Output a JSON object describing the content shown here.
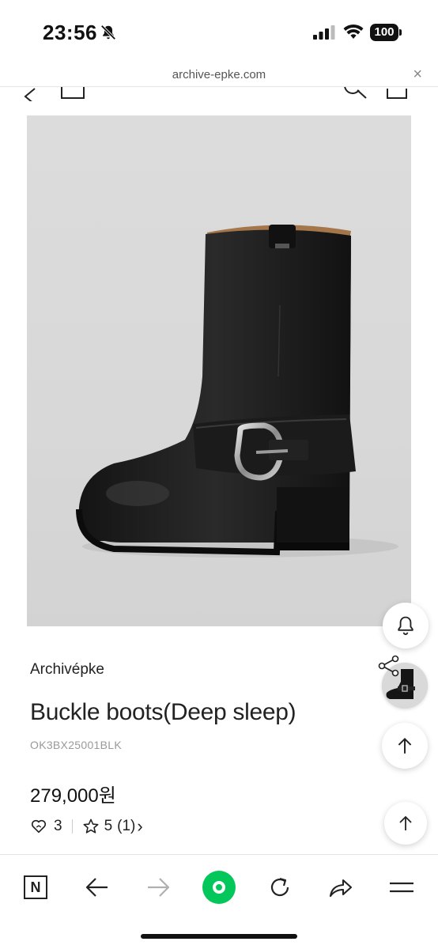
{
  "status_bar": {
    "time": "23:56",
    "battery": "100",
    "icons": [
      "bell-slash-icon",
      "cellular-signal-icon",
      "wifi-icon",
      "battery-icon"
    ]
  },
  "browser": {
    "url": "archive-epke.com",
    "close_icon": "×"
  },
  "product": {
    "brand": "Archivépke",
    "name": "Buckle boots(Deep sleep)",
    "sku": "OK3BX25001BLK",
    "price": "279,000원",
    "likes": "3",
    "rating": "5",
    "review_count": "(1)",
    "chevron": "›"
  },
  "floating": {
    "icons": [
      "bell-icon",
      "share-icon",
      "recent-product-thumbnail",
      "scroll-top-icon",
      "scroll-top-icon"
    ]
  },
  "toolbar": {
    "n_label": "N",
    "icons": [
      "naver-n-icon",
      "back-arrow-icon",
      "forward-arrow-icon",
      "green-dot-icon",
      "reload-icon",
      "share-arrow-icon",
      "menu-icon"
    ]
  },
  "colors": {
    "accent_green": "#03c75a",
    "image_bg": "#d9d9d9",
    "text": "#222222",
    "muted": "#9a9a9a"
  }
}
